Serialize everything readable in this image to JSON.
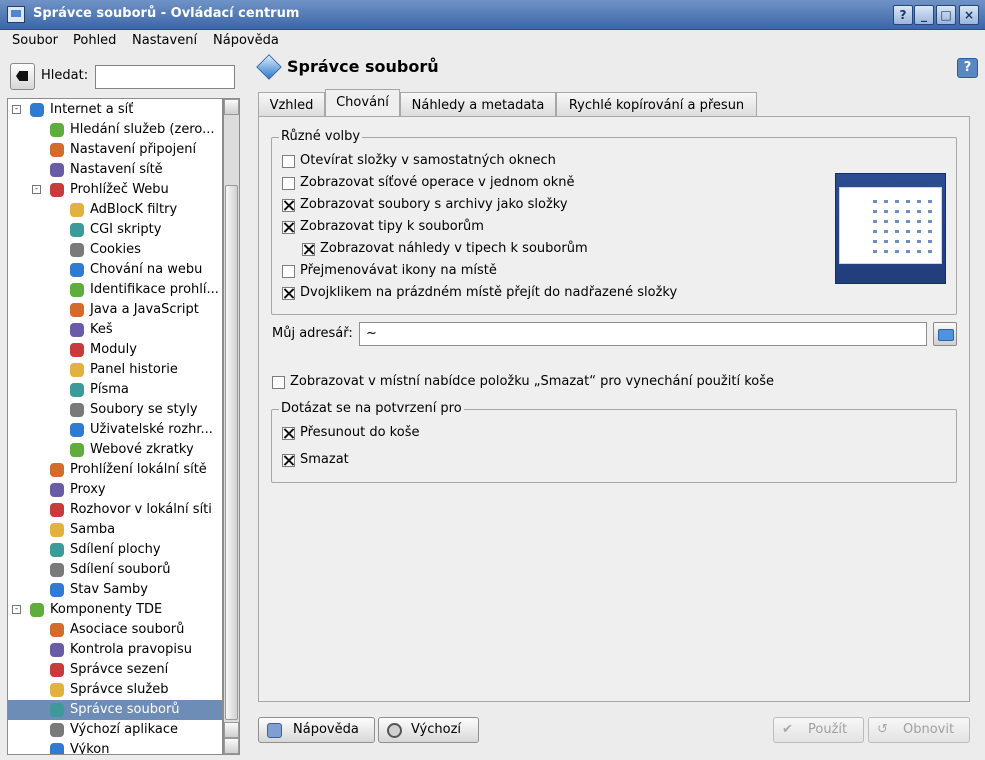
{
  "window": {
    "title": "Správce souborů - Ovládací centrum",
    "controls": [
      "?",
      "_",
      "□",
      "×"
    ]
  },
  "menu": [
    "Soubor",
    "Pohled",
    "Nastavení",
    "Nápověda"
  ],
  "search": {
    "label": "Hledat:",
    "value": ""
  },
  "sidebar": {
    "items": [
      {
        "label": "Internet a síť",
        "level": 0,
        "expander": "-",
        "icon": "globe-icon"
      },
      {
        "label": "Hledání služeb (zero...",
        "level": 1,
        "icon": "service-discovery-icon"
      },
      {
        "label": "Nastavení připojení",
        "level": 1,
        "icon": "connection-icon"
      },
      {
        "label": "Nastavení sítě",
        "level": 1,
        "icon": "network-icon"
      },
      {
        "label": "Prohlížeč Webu",
        "level": 1,
        "expander": "-",
        "icon": "web-browser-icon"
      },
      {
        "label": "AdBlocK filtry",
        "level": 2,
        "icon": "adblock-icon"
      },
      {
        "label": "CGI skripty",
        "level": 2,
        "icon": "cgi-icon"
      },
      {
        "label": "Cookies",
        "level": 2,
        "icon": "cookies-icon"
      },
      {
        "label": "Chování na webu",
        "level": 2,
        "icon": "web-behavior-icon"
      },
      {
        "label": "Identifikace prohlí...",
        "level": 2,
        "icon": "browser-identification-icon"
      },
      {
        "label": "Java a JavaScript",
        "level": 2,
        "icon": "java-icon"
      },
      {
        "label": "Keš",
        "level": 2,
        "icon": "cache-icon"
      },
      {
        "label": "Moduly",
        "level": 2,
        "icon": "plugins-icon"
      },
      {
        "label": "Panel historie",
        "level": 2,
        "icon": "history-icon"
      },
      {
        "label": "Písma",
        "level": 2,
        "icon": "fonts-icon"
      },
      {
        "label": "Soubory se styly",
        "level": 2,
        "icon": "stylesheets-icon"
      },
      {
        "label": "Uživatelské rozhr...",
        "level": 2,
        "icon": "user-interface-icon"
      },
      {
        "label": "Webové zkratky",
        "level": 2,
        "icon": "web-shortcuts-icon"
      },
      {
        "label": "Prohlížení lokální sítě",
        "level": 1,
        "icon": "local-network-icon"
      },
      {
        "label": "Proxy",
        "level": 1,
        "icon": "proxy-icon"
      },
      {
        "label": "Rozhovor v lokální síti",
        "level": 1,
        "icon": "lan-chat-icon"
      },
      {
        "label": "Samba",
        "level": 1,
        "icon": "samba-icon"
      },
      {
        "label": "Sdílení plochy",
        "level": 1,
        "icon": "desktop-sharing-icon"
      },
      {
        "label": "Sdílení souborů",
        "level": 1,
        "icon": "file-sharing-icon"
      },
      {
        "label": "Stav Samby",
        "level": 1,
        "icon": "samba-status-icon"
      },
      {
        "label": "Komponenty TDE",
        "level": 0,
        "expander": "-",
        "icon": "components-icon"
      },
      {
        "label": "Asociace souborů",
        "level": 1,
        "icon": "file-associations-icon"
      },
      {
        "label": "Kontrola pravopisu",
        "level": 1,
        "icon": "spellcheck-icon"
      },
      {
        "label": "Správce sezení",
        "level": 1,
        "icon": "session-manager-icon"
      },
      {
        "label": "Správce služeb",
        "level": 1,
        "icon": "service-manager-icon"
      },
      {
        "label": "Správce souborů",
        "level": 1,
        "icon": "file-manager-icon",
        "selected": true
      },
      {
        "label": "Výchozí aplikace",
        "level": 1,
        "icon": "default-apps-icon"
      },
      {
        "label": "Výkon",
        "level": 1,
        "icon": "performance-icon"
      }
    ]
  },
  "page": {
    "title": "Správce souborů",
    "help": "?"
  },
  "tabs": [
    "Vzhled",
    "Chování",
    "Náhledy a metadata",
    "Rychlé kopírování a přesun"
  ],
  "active_tab": "Chování",
  "misc_group": {
    "title": "Různé volby",
    "options": [
      {
        "label": "Otevírat složky v samostatných oknech",
        "checked": false
      },
      {
        "label": "Zobrazovat síťové operace v jednom okně",
        "checked": false
      },
      {
        "label": "Zobrazovat soubory s archivy jako složky",
        "checked": true
      },
      {
        "label": "Zobrazovat tipy k souborům",
        "checked": true
      },
      {
        "label": "Zobrazovat náhledy v tipech k souborům",
        "checked": true,
        "indent": true
      },
      {
        "label": "Přejmenovávat ikony na místě",
        "checked": false
      },
      {
        "label": "Dvojklikem na prázdném místě přejít do nadřazené složky",
        "checked": true
      }
    ]
  },
  "address": {
    "label": "Můj adresář:",
    "value": "~"
  },
  "delete_option": {
    "label": "Zobrazovat v místní nabídce položku „Smazat“ pro vynechání použití koše",
    "checked": false
  },
  "confirm_group": {
    "title": "Dotázat se na potvrzení pro",
    "options": [
      {
        "label": "Přesunout do koše",
        "checked": true
      },
      {
        "label": "Smazat",
        "checked": true
      }
    ]
  },
  "buttons": {
    "help": "Nápověda",
    "defaults": "Výchozí",
    "apply": "Použít",
    "reset": "Obnovit"
  },
  "colors": {
    "titlebar": "#4a72b0",
    "selection": "#6d8db6"
  }
}
